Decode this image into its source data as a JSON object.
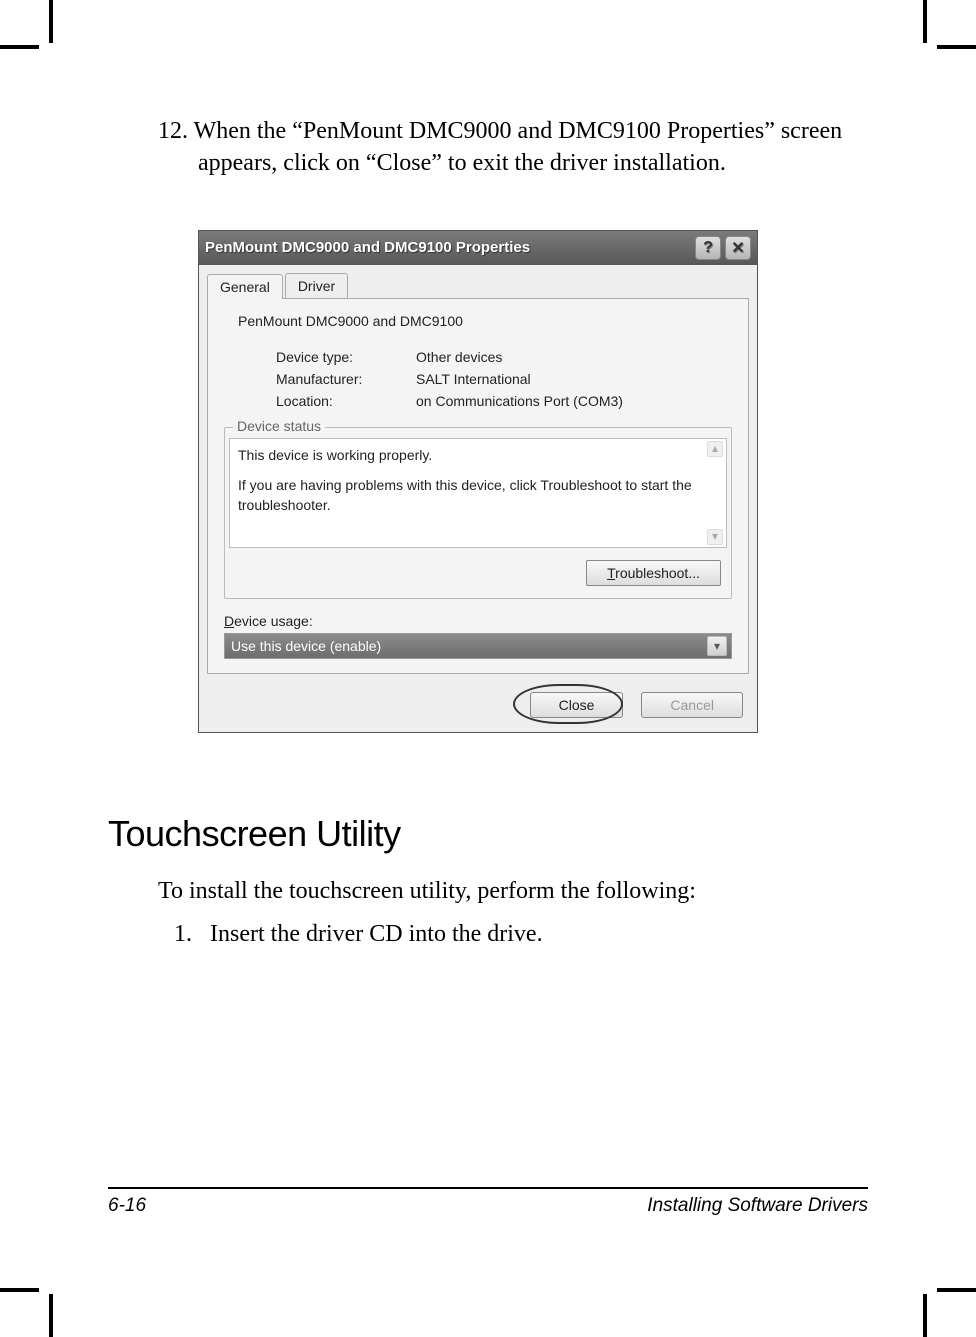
{
  "step": {
    "number": "12.",
    "text": "When the “PenMount DMC9000 and DMC9100 Properties” screen appears, click on “Close” to exit the driver installation."
  },
  "dialog": {
    "title": "PenMount DMC9000 and DMC9100 Properties",
    "help_glyph": "?",
    "close_glyph": "✕",
    "tabs": {
      "general": "General",
      "driver": "Driver"
    },
    "device_name": "PenMount DMC9000 and DMC9100",
    "rows": {
      "type_label": "Device type:",
      "type_value": "Other devices",
      "mfr_label": "Manufacturer:",
      "mfr_value": "SALT International",
      "loc_label": "Location:",
      "loc_value": "on Communications Port (COM3)"
    },
    "status": {
      "legend": "Device status",
      "line1": "This device is working properly.",
      "line2": "If you are having problems with this device, click Troubleshoot to start the troubleshooter.",
      "button": "Troubleshoot..."
    },
    "usage": {
      "label_pre": "D",
      "label_rest": "evice usage:",
      "selected": "Use this device (enable)"
    },
    "footer": {
      "close": "Close",
      "cancel": "Cancel"
    }
  },
  "section": {
    "heading": "Touchscreen Utility",
    "intro": "To install the touchscreen utility, perform the following:",
    "item1_num": "1.",
    "item1_text": "Insert the driver CD into the drive."
  },
  "page_footer": {
    "left": "6-16",
    "right": "Installing Software Drivers"
  }
}
